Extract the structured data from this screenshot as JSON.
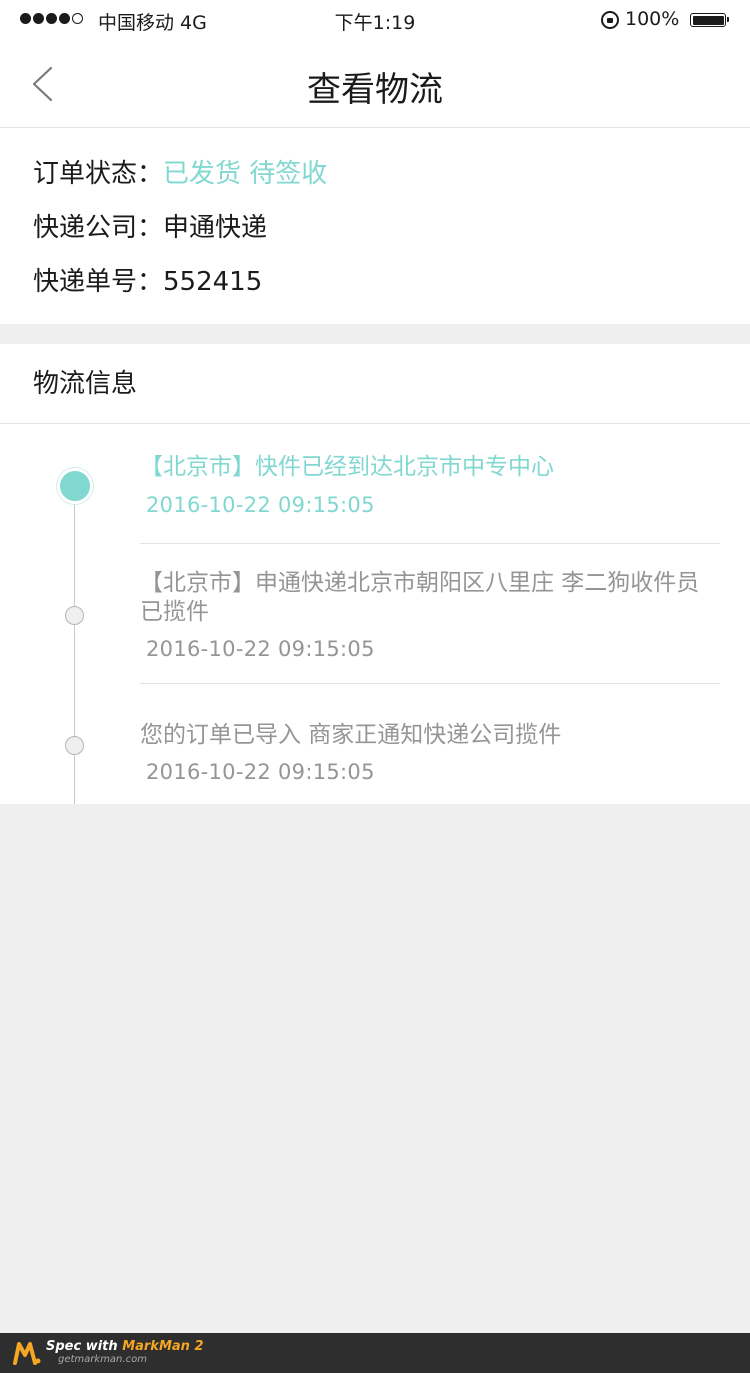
{
  "status_bar": {
    "carrier": "中国移动 4G",
    "time": "下午1:19",
    "battery": "100%"
  },
  "nav": {
    "title": "查看物流"
  },
  "order": {
    "status_label": "订单状态：",
    "status_value": "已发货 待签收",
    "company_label": "快递公司：",
    "company_value": "申通快递",
    "number_label": "快递单号：",
    "number_value": "552415"
  },
  "logistics": {
    "title": "物流信息",
    "events": [
      {
        "text": "【北京市】快件已经到达北京市中专中心",
        "time": "2016-10-22  09:15:05"
      },
      {
        "text": "【北京市】申通快递北京市朝阳区八里庄 李二狗收件员 已揽件",
        "time": "2016-10-22  09:15:05"
      },
      {
        "text": "您的订单已导入 商家正通知快递公司揽件",
        "time": "2016-10-22  09:15:05"
      }
    ]
  },
  "colors": {
    "text_primary": "#1b1b1b",
    "accent": "#81d8d0",
    "text_secondary": "#959595"
  },
  "footer": {
    "spec_prefix": "Spec with ",
    "brand": "MarkMan 2",
    "url": "getmarkman.com"
  }
}
